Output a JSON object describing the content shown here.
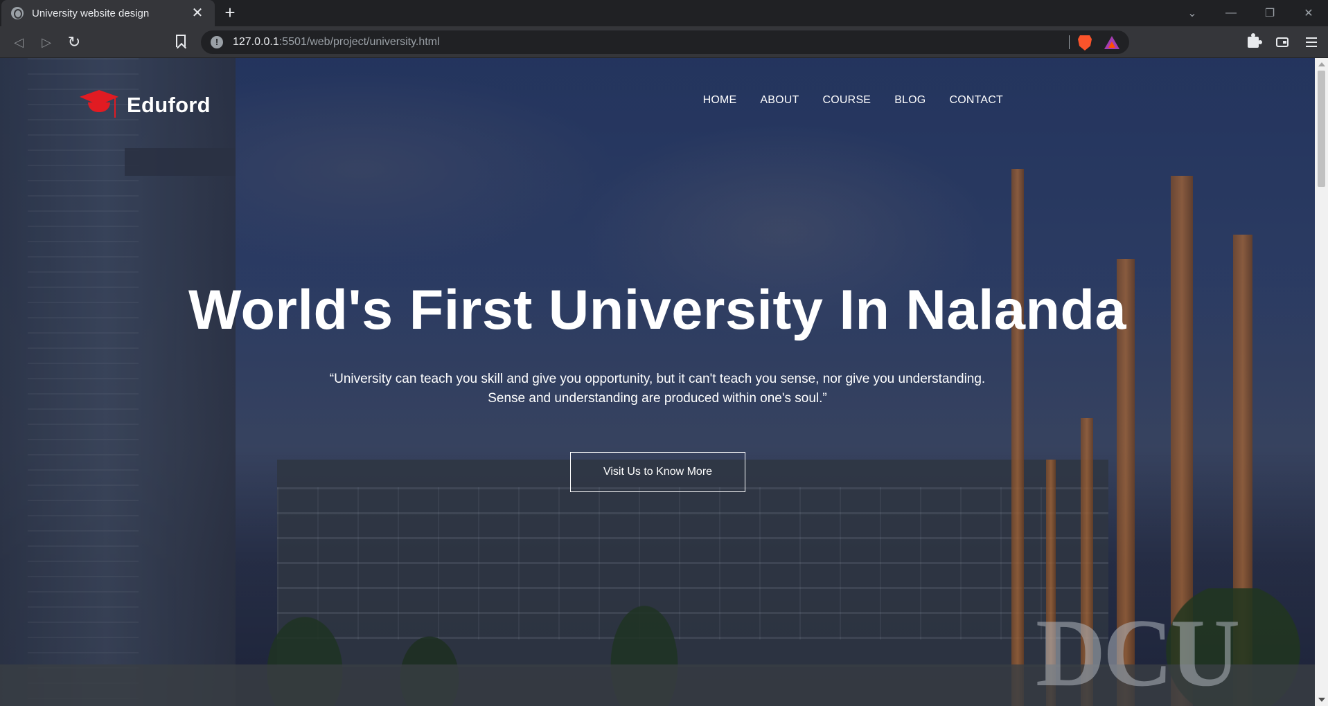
{
  "browser": {
    "tab_title": "University website design",
    "tab_close": "✕",
    "new_tab": "+",
    "url_host": "127.0.0.1",
    "url_rest": ":5501/web/project/university.html",
    "window_controls": [
      "⌄",
      "—",
      "❐",
      "✕"
    ]
  },
  "site": {
    "brand": "Eduford",
    "nav": [
      "HOME",
      "ABOUT",
      "COURSE",
      "BLOG",
      "CONTACT"
    ],
    "hero_title": "World's First University In Nalanda",
    "hero_quote_line1": "“University can teach you skill and give you opportunity, but it can't teach you sense, nor give you understanding.",
    "hero_quote_line2": "Sense and understanding are produced within one's soul.”",
    "cta_label": "Visit Us to Know More",
    "background_sign": "DCU",
    "accent_color": "#e11b22"
  }
}
